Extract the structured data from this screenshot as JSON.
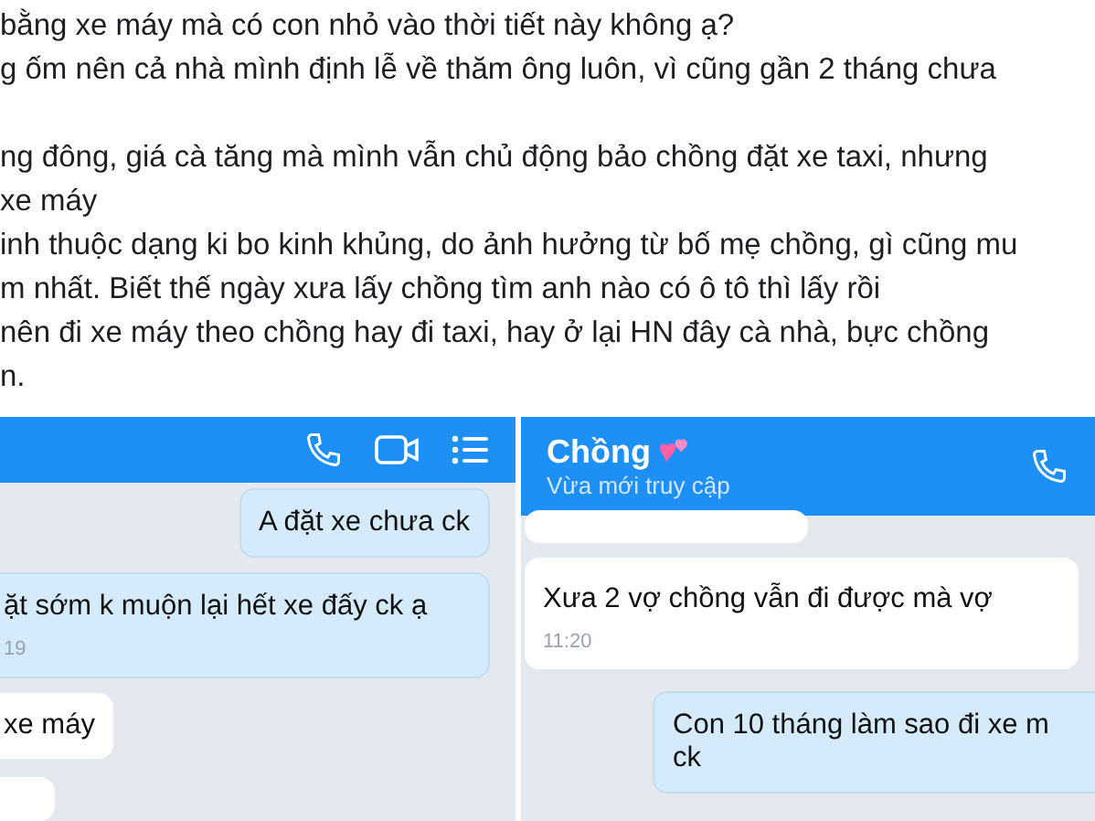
{
  "post": {
    "lines": [
      "bằng xe máy mà có con nhỏ vào thời tiết này không ạ?",
      "g ốm nên cả nhà mình định lễ về thăm ông luôn, vì cũng gần 2 tháng chưa",
      "ng đông, giá cà tăng mà mình vẫn chủ động bảo chồng đặt xe taxi, nhưng",
      "xe máy",
      "inh thuộc dạng ki bo kinh khủng, do ảnh hưởng từ bố mẹ chồng, gì cũng mu",
      "m nhất. Biết thế ngày xưa lấy chồng tìm anh nào có ô tô thì lấy rồi",
      "nên đi xe máy theo chồng hay đi taxi, hay ở lại HN đây cà nhà, bực chồng",
      "n."
    ]
  },
  "chats": [
    {
      "header": {
        "buttons": [
          {
            "kind": "call"
          },
          {
            "kind": "video"
          },
          {
            "kind": "menu"
          }
        ]
      },
      "messages": [
        {
          "kind": "sent",
          "text": "A đặt xe chưa ck"
        },
        {
          "kind": "sent",
          "text": "ặt sớm k muộn lại hết xe đấy ck ạ",
          "time": "19"
        },
        {
          "kind": "received",
          "text": "xe máy"
        },
        {
          "kind": "received"
        }
      ]
    },
    {
      "header": {
        "title": "Chồng",
        "subtitle": "Vừa mới truy cập",
        "buttons": [
          {
            "kind": "call"
          }
        ]
      },
      "messages": [
        {
          "kind": "received"
        },
        {
          "kind": "received",
          "text": "Xưa 2 vợ chồng vẫn đi được mà vợ",
          "time": "11:20"
        },
        {
          "kind": "sent",
          "text": "Con 10 tháng làm sao đi xe m\nck"
        }
      ]
    }
  ]
}
